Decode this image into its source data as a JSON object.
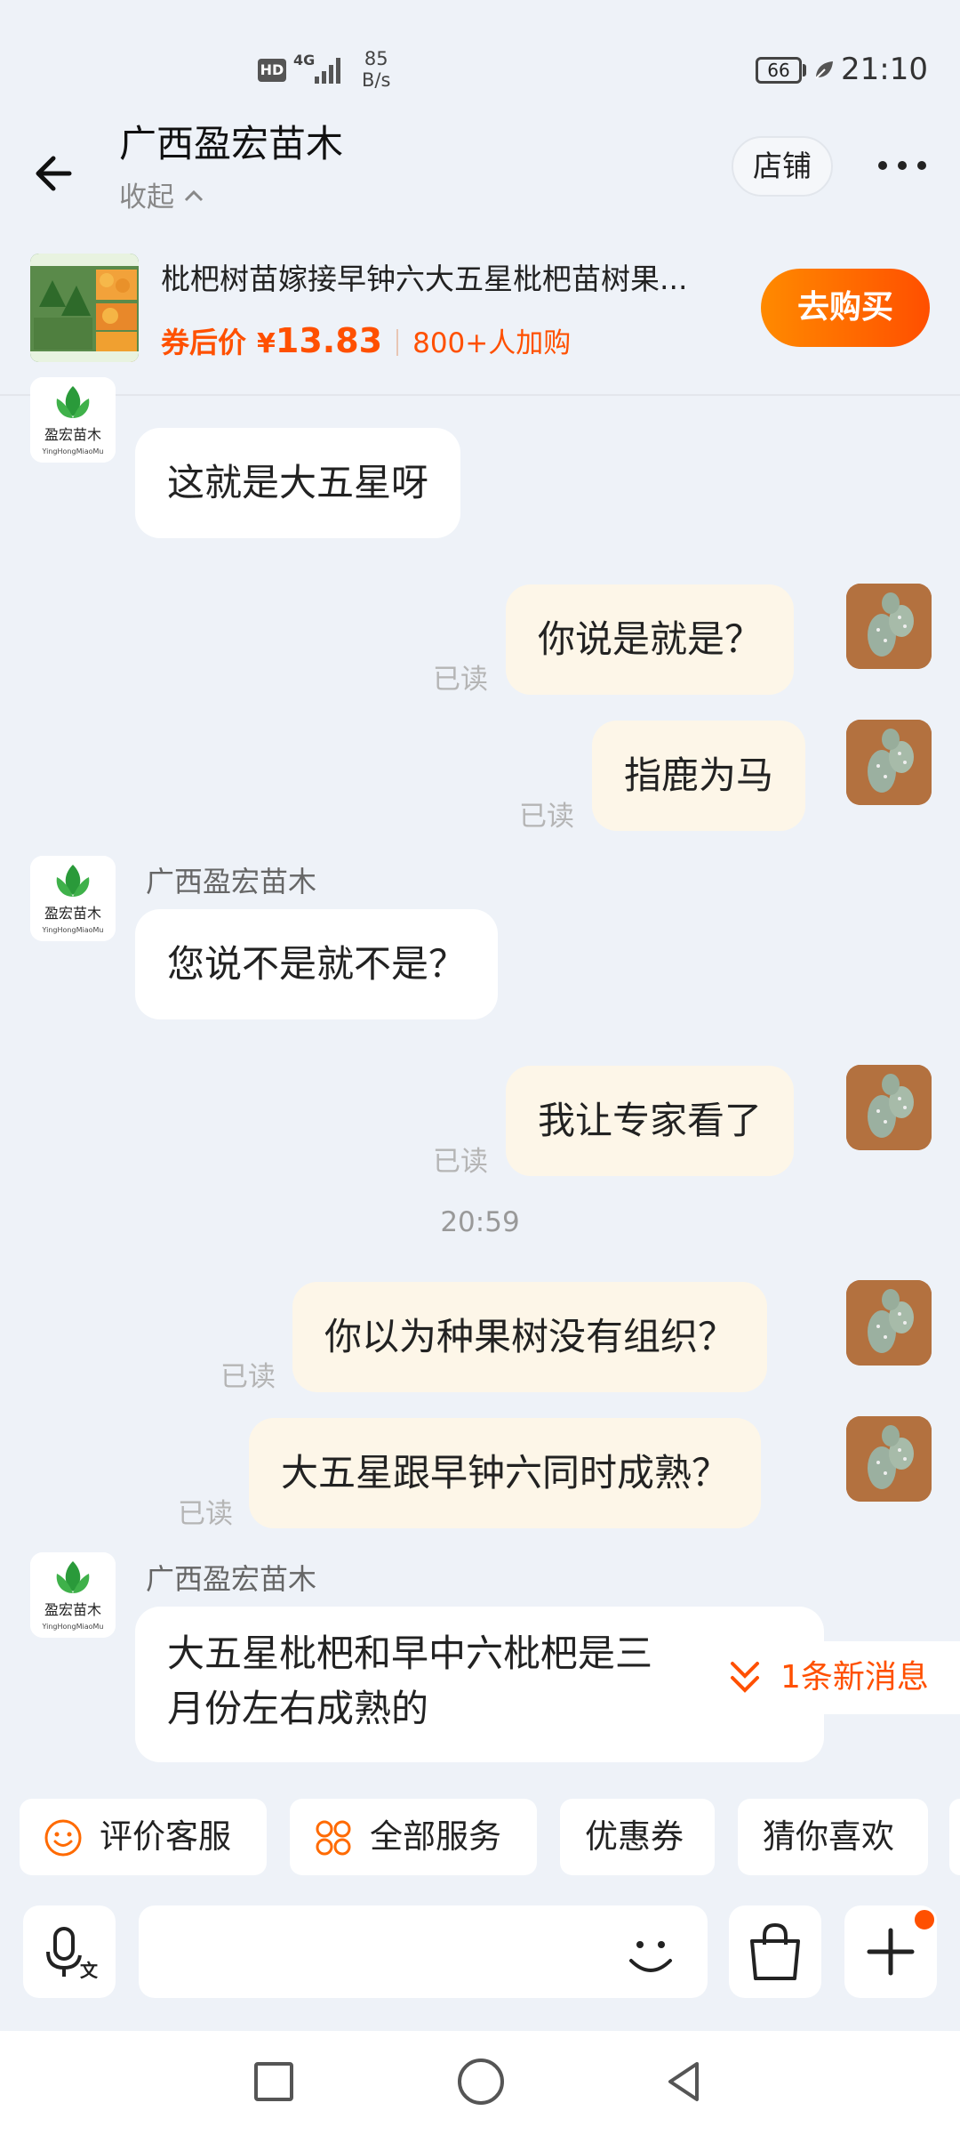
{
  "status_bar": {
    "hd": "HD",
    "network": "4G",
    "speed_value": "85",
    "speed_unit": "B/s",
    "battery": "66",
    "time": "21:10"
  },
  "header": {
    "title": "广西盈宏苗木",
    "collapse_label": "收起",
    "store_label": "店铺"
  },
  "product": {
    "title": "枇杷树苗嫁接早钟六大五星枇杷苗树果...",
    "price_label": "券后价",
    "currency": "¥",
    "price": "13.83",
    "buyers": "800+人加购",
    "buy_label": "去购买"
  },
  "chat": {
    "shop_name": "广西盈宏苗木",
    "read_label": "已读",
    "time_separator": "20:59",
    "messages": [
      {
        "from": "shop",
        "text": "这就是大五星呀"
      },
      {
        "from": "me",
        "text": "你说是就是？"
      },
      {
        "from": "me",
        "text": "指鹿为马"
      },
      {
        "from": "shop",
        "text": "您说不是就不是？"
      },
      {
        "from": "me",
        "text": "我让专家看了"
      },
      {
        "from": "me",
        "text": "你以为种果树没有组织？"
      },
      {
        "from": "me",
        "text": "大五星跟早钟六同时成熟？"
      },
      {
        "from": "shop",
        "text_line1": "大五星枇杷和早中六枇杷是三",
        "text_line2": "月份左右成熟的"
      }
    ],
    "new_message_label": "1条新消息"
  },
  "services": {
    "rate_service": "评价客服",
    "all_services": "全部服务",
    "coupons": "优惠券",
    "you_may_like": "猜你喜欢"
  },
  "input": {
    "placeholder": ""
  },
  "colors": {
    "accent": "#ff5000",
    "bubble_out": "#fdf6e8",
    "bubble_in": "#ffffff",
    "background": "#eef2f8"
  }
}
